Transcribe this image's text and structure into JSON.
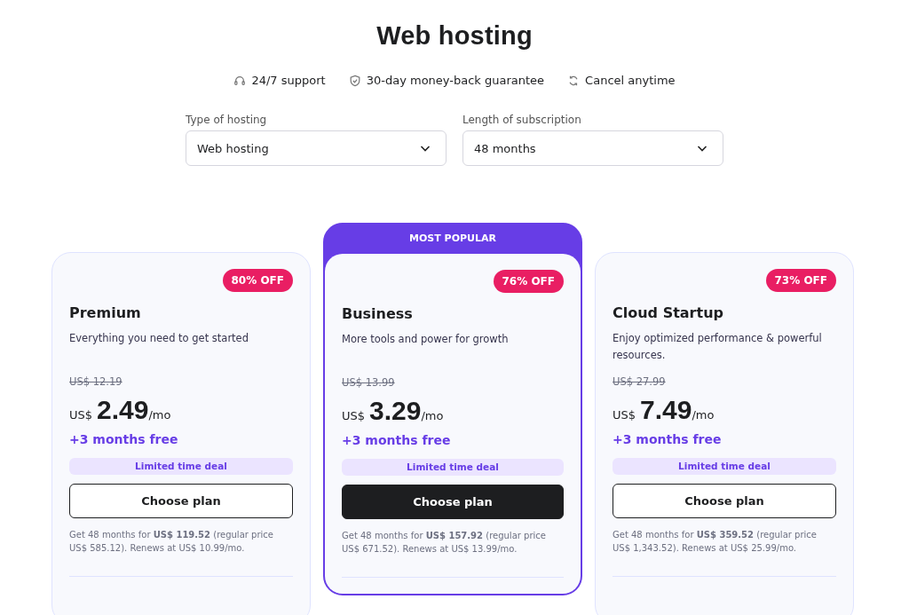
{
  "title": "Web hosting",
  "features": [
    {
      "kind": "headset",
      "label": "24/7 support"
    },
    {
      "kind": "shield",
      "label": "30-day money-back guarantee"
    },
    {
      "kind": "cycle",
      "label": "Cancel anytime"
    }
  ],
  "selectors": [
    {
      "label": "Type of hosting",
      "value": "Web hosting"
    },
    {
      "label": "Length of subscription",
      "value": "48 months"
    }
  ],
  "plans": [
    {
      "featured": false,
      "discount": "80% OFF",
      "name": "Premium",
      "description": "Everything you need to get started",
      "old_price": "US$ 12.19",
      "currency": "US$",
      "price": "2.49",
      "period": "/mo",
      "bonus": "+3 months free",
      "deal": "Limited time deal",
      "button": "Choose plan",
      "note": "Get 48 months for **US$ 119.52** (regular price US$ 585.12). Renews at US$ 10.99/mo."
    },
    {
      "featured": true,
      "ribbon": "MOST POPULAR",
      "discount": "76% OFF",
      "name": "Business",
      "description": "More tools and power for growth",
      "old_price": "US$ 13.99",
      "currency": "US$",
      "price": "3.29",
      "period": "/mo",
      "bonus": "+3 months free",
      "deal": "Limited time deal",
      "button": "Choose plan",
      "note": "Get 48 months for **US$ 157.92** (regular price US$ 671.52). Renews at US$ 13.99/mo."
    },
    {
      "featured": false,
      "discount": "73% OFF",
      "name": "Cloud Startup",
      "description": "Enjoy optimized performance & powerful resources.",
      "old_price": "US$ 27.99",
      "currency": "US$",
      "price": "7.49",
      "period": "/mo",
      "bonus": "+3 months free",
      "deal": "Limited time deal",
      "button": "Choose plan",
      "note": "Get 48 months for **US$ 359.52** (regular price US$ 1,343.52). Renews at US$ 25.99/mo."
    }
  ]
}
